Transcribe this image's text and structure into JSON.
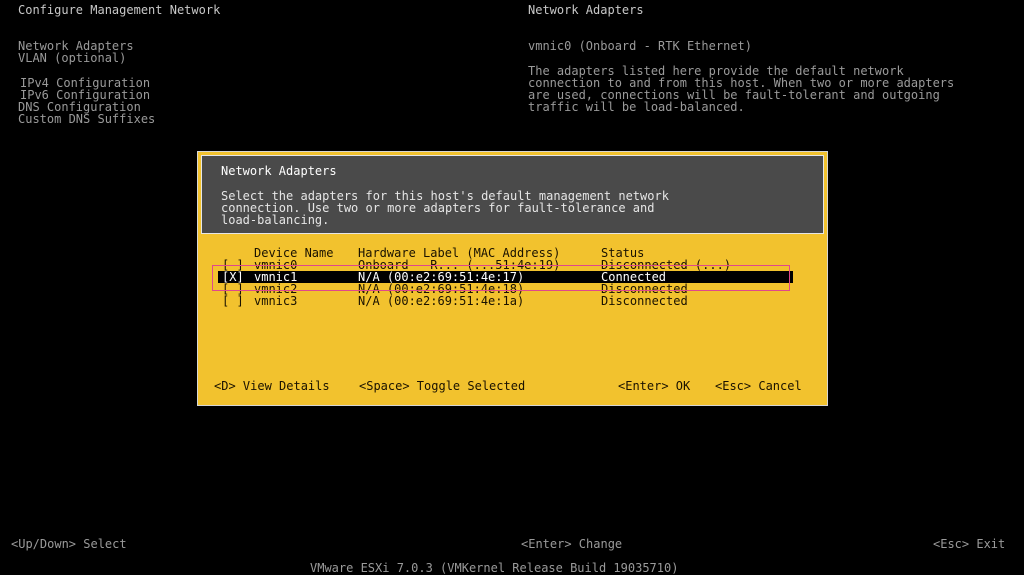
{
  "left_header": "Configure Management Network",
  "right_header": "Network Adapters",
  "menu": [
    "Network Adapters",
    "VLAN (optional)",
    "IPv4 Configuration",
    "IPv6 Configuration",
    "DNS Configuration",
    "Custom DNS Suffixes"
  ],
  "right_panel": {
    "adapter": "vmnic0 (Onboard - RTK Ethernet)",
    "desc": [
      "The adapters listed here provide the default network",
      "connection to and from this host. When two or more adapters",
      "are used, connections will be fault-tolerant and outgoing",
      "traffic will be load-balanced."
    ]
  },
  "dialog": {
    "title": "Network Adapters",
    "desc": [
      "Select the adapters for this host's default management network",
      "connection. Use two or more adapters for fault-tolerance and",
      "load-balancing."
    ],
    "columns": {
      "device": "Device Name",
      "hw": "Hardware Label (MAC Address)",
      "status": "Status"
    },
    "rows": [
      {
        "check": "[ ]",
        "device": "vmnic0",
        "hw": "Onboard - R... (...51:4e:19)",
        "status": "Disconnected (...)"
      },
      {
        "check": "[X]",
        "device": "vmnic1",
        "hw": "N/A (00:e2:69:51:4e:17)",
        "status": "Connected"
      },
      {
        "check": "[ ]",
        "device": "vmnic2",
        "hw": "N/A (00:e2:69:51:4e:18)",
        "status": "Disconnected"
      },
      {
        "check": "[ ]",
        "device": "vmnic3",
        "hw": "N/A (00:e2:69:51:4e:1a)",
        "status": "Disconnected"
      }
    ],
    "actions": {
      "view": "<D> View Details",
      "toggle": "<Space> Toggle Selected",
      "ok": "<Enter> OK",
      "cancel": "<Esc> Cancel"
    }
  },
  "footer": {
    "select": "<Up/Down> Select",
    "change": "<Enter> Change",
    "exit": "<Esc> Exit",
    "version": "VMware ESXi 7.0.3 (VMKernel Release Build 19035710)"
  }
}
